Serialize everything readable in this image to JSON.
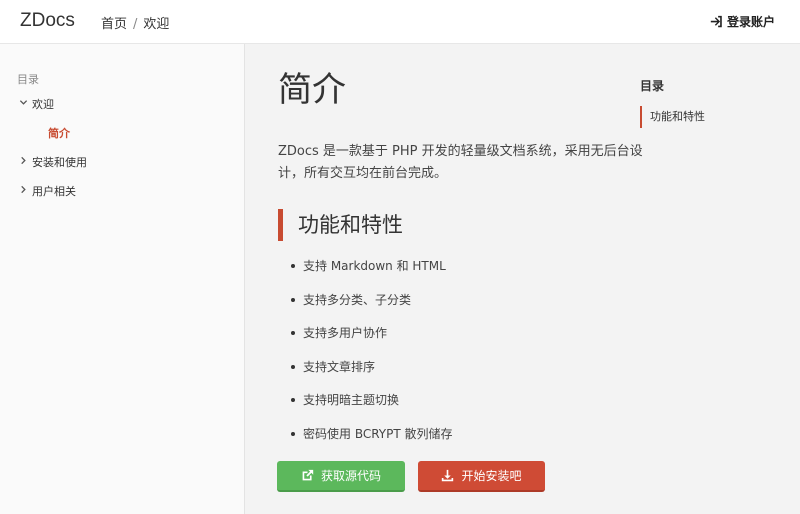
{
  "header": {
    "logo": "ZDocs",
    "breadcrumb": [
      "首页",
      "欢迎"
    ],
    "breadcrumb_separator": "/",
    "login_label": "登录账户",
    "login_icon": "sign-in-icon"
  },
  "sidebar": {
    "heading": "目录",
    "items": [
      {
        "label": "欢迎",
        "expanded": true,
        "chevron": "⌄"
      },
      {
        "label": "安装和使用",
        "expanded": false,
        "chevron": "›"
      },
      {
        "label": "用户相关",
        "expanded": false,
        "chevron": "›"
      }
    ],
    "active_sub": "简介"
  },
  "main": {
    "title": "简介",
    "intro": "ZDocs 是一款基于 PHP 开发的轻量级文档系统，采用无后台设计，所有交互均在前台完成。",
    "section_title": "功能和特性",
    "features": [
      "支持 Markdown 和 HTML",
      "支持多分类、子分类",
      "支持多用户协作",
      "支持文章排序",
      "支持明暗主题切换",
      "密码使用 BCRYPT 散列储存"
    ],
    "buttons": {
      "source": "获取源代码",
      "install": "开始安装吧"
    }
  },
  "toc": {
    "title": "目录",
    "items": [
      "功能和特性"
    ]
  },
  "colors": {
    "accent": "#c84b31",
    "green": "#5cb85c",
    "red": "#cf4b35"
  }
}
